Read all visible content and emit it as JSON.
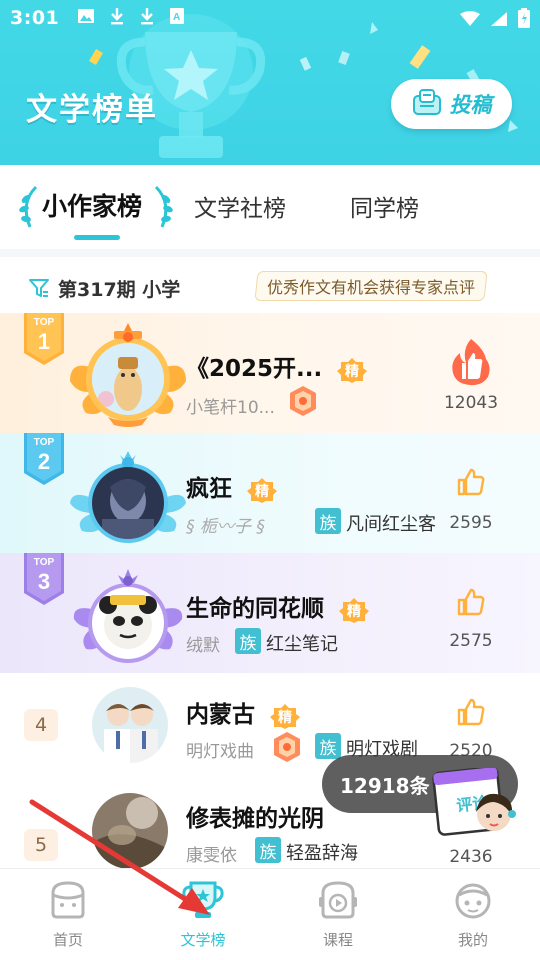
{
  "status_bar": {
    "time": "3:01"
  },
  "header": {
    "title": "文学榜单",
    "submit_label": "投稿"
  },
  "tabs": [
    {
      "label": "小作家榜",
      "active": true
    },
    {
      "label": "文学社榜",
      "active": false
    },
    {
      "label": "同学榜",
      "active": false
    }
  ],
  "filter": {
    "label": "第317期 小学",
    "promo": "优秀作文有机会获得专家点评"
  },
  "rankings": [
    {
      "rank": "1",
      "top_label": "TOP",
      "title": "《2025开...",
      "featured": "精",
      "author": "小笔杆10...",
      "clan": "",
      "likes": "12043"
    },
    {
      "rank": "2",
      "top_label": "TOP",
      "title": "疯狂",
      "featured": "精",
      "author": "栀〰子",
      "clan_tag": "族",
      "clan": "凡间红尘客",
      "likes": "2595"
    },
    {
      "rank": "3",
      "top_label": "TOP",
      "title": "生命的同花顺",
      "featured": "精",
      "author": "绒默",
      "clan_tag": "族",
      "clan": "红尘笔记",
      "likes": "2575"
    },
    {
      "rank": "4",
      "title": "内蒙古",
      "featured": "精",
      "author": "明灯戏曲",
      "clan_tag": "族",
      "clan": "明灯戏剧",
      "likes": "2520"
    },
    {
      "rank": "5",
      "title": "修表摊的光阴",
      "author": "康雯依",
      "clan_tag": "族",
      "clan": "轻盈辞海",
      "likes": "2436"
    }
  ],
  "comment_float": {
    "count": "12918条",
    "label": "评论"
  },
  "bottom_nav": [
    {
      "label": "首页",
      "active": false
    },
    {
      "label": "文学榜",
      "active": true
    },
    {
      "label": "课程",
      "active": false
    },
    {
      "label": "我的",
      "active": false
    }
  ],
  "colors": {
    "accent": "#2cc5d8",
    "header_bg": "#40d5e6",
    "clan_badge": "#42bfd0",
    "annotation_arrow": "#e53935"
  }
}
